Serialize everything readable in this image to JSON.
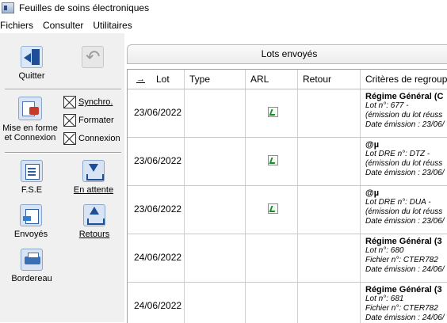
{
  "window": {
    "title": "Feuilles de soins électroniques",
    "app_icon": "window-app-icon"
  },
  "menu": [
    "Fichiers",
    "Consulter",
    "Utilitaires"
  ],
  "sidebar": {
    "quit_label": "Quitter",
    "back_label": "",
    "mise_label_1": "Mise en forme",
    "mise_label_2": "et Connexion",
    "checks": [
      {
        "label": "Synchro.",
        "checked": true
      },
      {
        "label": "Formater",
        "checked": true
      },
      {
        "label": "Connexion",
        "checked": true
      }
    ],
    "fse_label": "F.S.E",
    "attente_label": "En attente",
    "envoyes_label": "Envoyés",
    "retours_label": "Retours",
    "bordereau_label": "Bordereau"
  },
  "panel": {
    "title": "Lots envoyés"
  },
  "table": {
    "columns": [
      "Lot",
      "Type",
      "ARL",
      "Retour",
      "Critères de regroupem"
    ],
    "rows": [
      {
        "date": "23/06/2022",
        "arl": true,
        "crit_title": "Régime Général (C",
        "crit_lines": [
          "Lot n°: 677 -",
          " (émission du lot réuss",
          "Date émission : 23/06/"
        ]
      },
      {
        "date": "23/06/2022",
        "arl": true,
        "crit_title": "@µ",
        "crit_lines": [
          "Lot DRE n°: DTZ -",
          " (émission du lot réuss",
          "Date émission : 23/06/"
        ]
      },
      {
        "date": "23/06/2022",
        "arl": true,
        "crit_title": "@µ",
        "crit_lines": [
          "Lot DRE n°: DUA -",
          " (émission du lot réuss",
          "Date émission : 23/06/"
        ]
      },
      {
        "date": "24/06/2022",
        "arl": false,
        "crit_title": "Régime Général (3",
        "crit_lines": [
          "Lot n°: 680",
          "Fichier n°: CTER782",
          "Date émission : 24/06/"
        ]
      },
      {
        "date": "24/06/2022",
        "arl": false,
        "crit_title": "Régime Général (3",
        "crit_lines": [
          "Lot n°: 681",
          "Fichier n°: CTER782",
          "Date émission : 24/06/"
        ]
      }
    ]
  }
}
